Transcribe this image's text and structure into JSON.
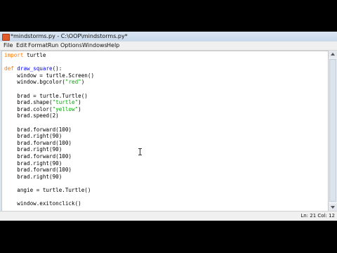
{
  "window": {
    "title": "*mindstorms.py - C:\\OOP\\mindstorms.py*",
    "icon": "python-file-icon"
  },
  "menu": [
    "File",
    "Edit",
    "Format",
    "Run",
    "Options",
    "Windows",
    "Help"
  ],
  "code_lines": [
    [
      {
        "t": "import",
        "c": "kw"
      },
      {
        "t": " turtle",
        "c": ""
      }
    ],
    [],
    [
      {
        "t": "def",
        "c": "kw"
      },
      {
        "t": " ",
        "c": ""
      },
      {
        "t": "draw_square",
        "c": "def"
      },
      {
        "t": "():",
        "c": ""
      }
    ],
    [
      {
        "t": "    window = turtle.Screen()",
        "c": ""
      }
    ],
    [
      {
        "t": "    window.bgcolor(",
        "c": ""
      },
      {
        "t": "\"red\"",
        "c": "str"
      },
      {
        "t": ")",
        "c": ""
      }
    ],
    [],
    [
      {
        "t": "    brad = turtle.Turtle()",
        "c": ""
      }
    ],
    [
      {
        "t": "    brad.shape(",
        "c": ""
      },
      {
        "t": "\"turtle\"",
        "c": "str"
      },
      {
        "t": ")",
        "c": ""
      }
    ],
    [
      {
        "t": "    brad.color(",
        "c": ""
      },
      {
        "t": "\"yellow\"",
        "c": "str"
      },
      {
        "t": ")",
        "c": ""
      }
    ],
    [
      {
        "t": "    brad.speed(2)",
        "c": ""
      }
    ],
    [],
    [
      {
        "t": "    brad.forward(100)",
        "c": ""
      }
    ],
    [
      {
        "t": "    brad.right(90)",
        "c": ""
      }
    ],
    [
      {
        "t": "    brad.forward(100)",
        "c": ""
      }
    ],
    [
      {
        "t": "    brad.right(90)",
        "c": ""
      }
    ],
    [
      {
        "t": "    brad.forward(100)",
        "c": ""
      }
    ],
    [
      {
        "t": "    brad.right(90)",
        "c": ""
      }
    ],
    [
      {
        "t": "    brad.forward(100)",
        "c": ""
      }
    ],
    [
      {
        "t": "    brad.right(90)",
        "c": ""
      }
    ],
    [],
    [
      {
        "t": "    angie = turtle.Turtle()",
        "c": ""
      }
    ],
    [],
    [
      {
        "t": "    window.exitonclick()",
        "c": ""
      }
    ]
  ],
  "status": "Ln: 21 Col: 12",
  "colors": {
    "keyword": "#ff7700",
    "definition": "#0000ff",
    "string": "#00aa00"
  }
}
